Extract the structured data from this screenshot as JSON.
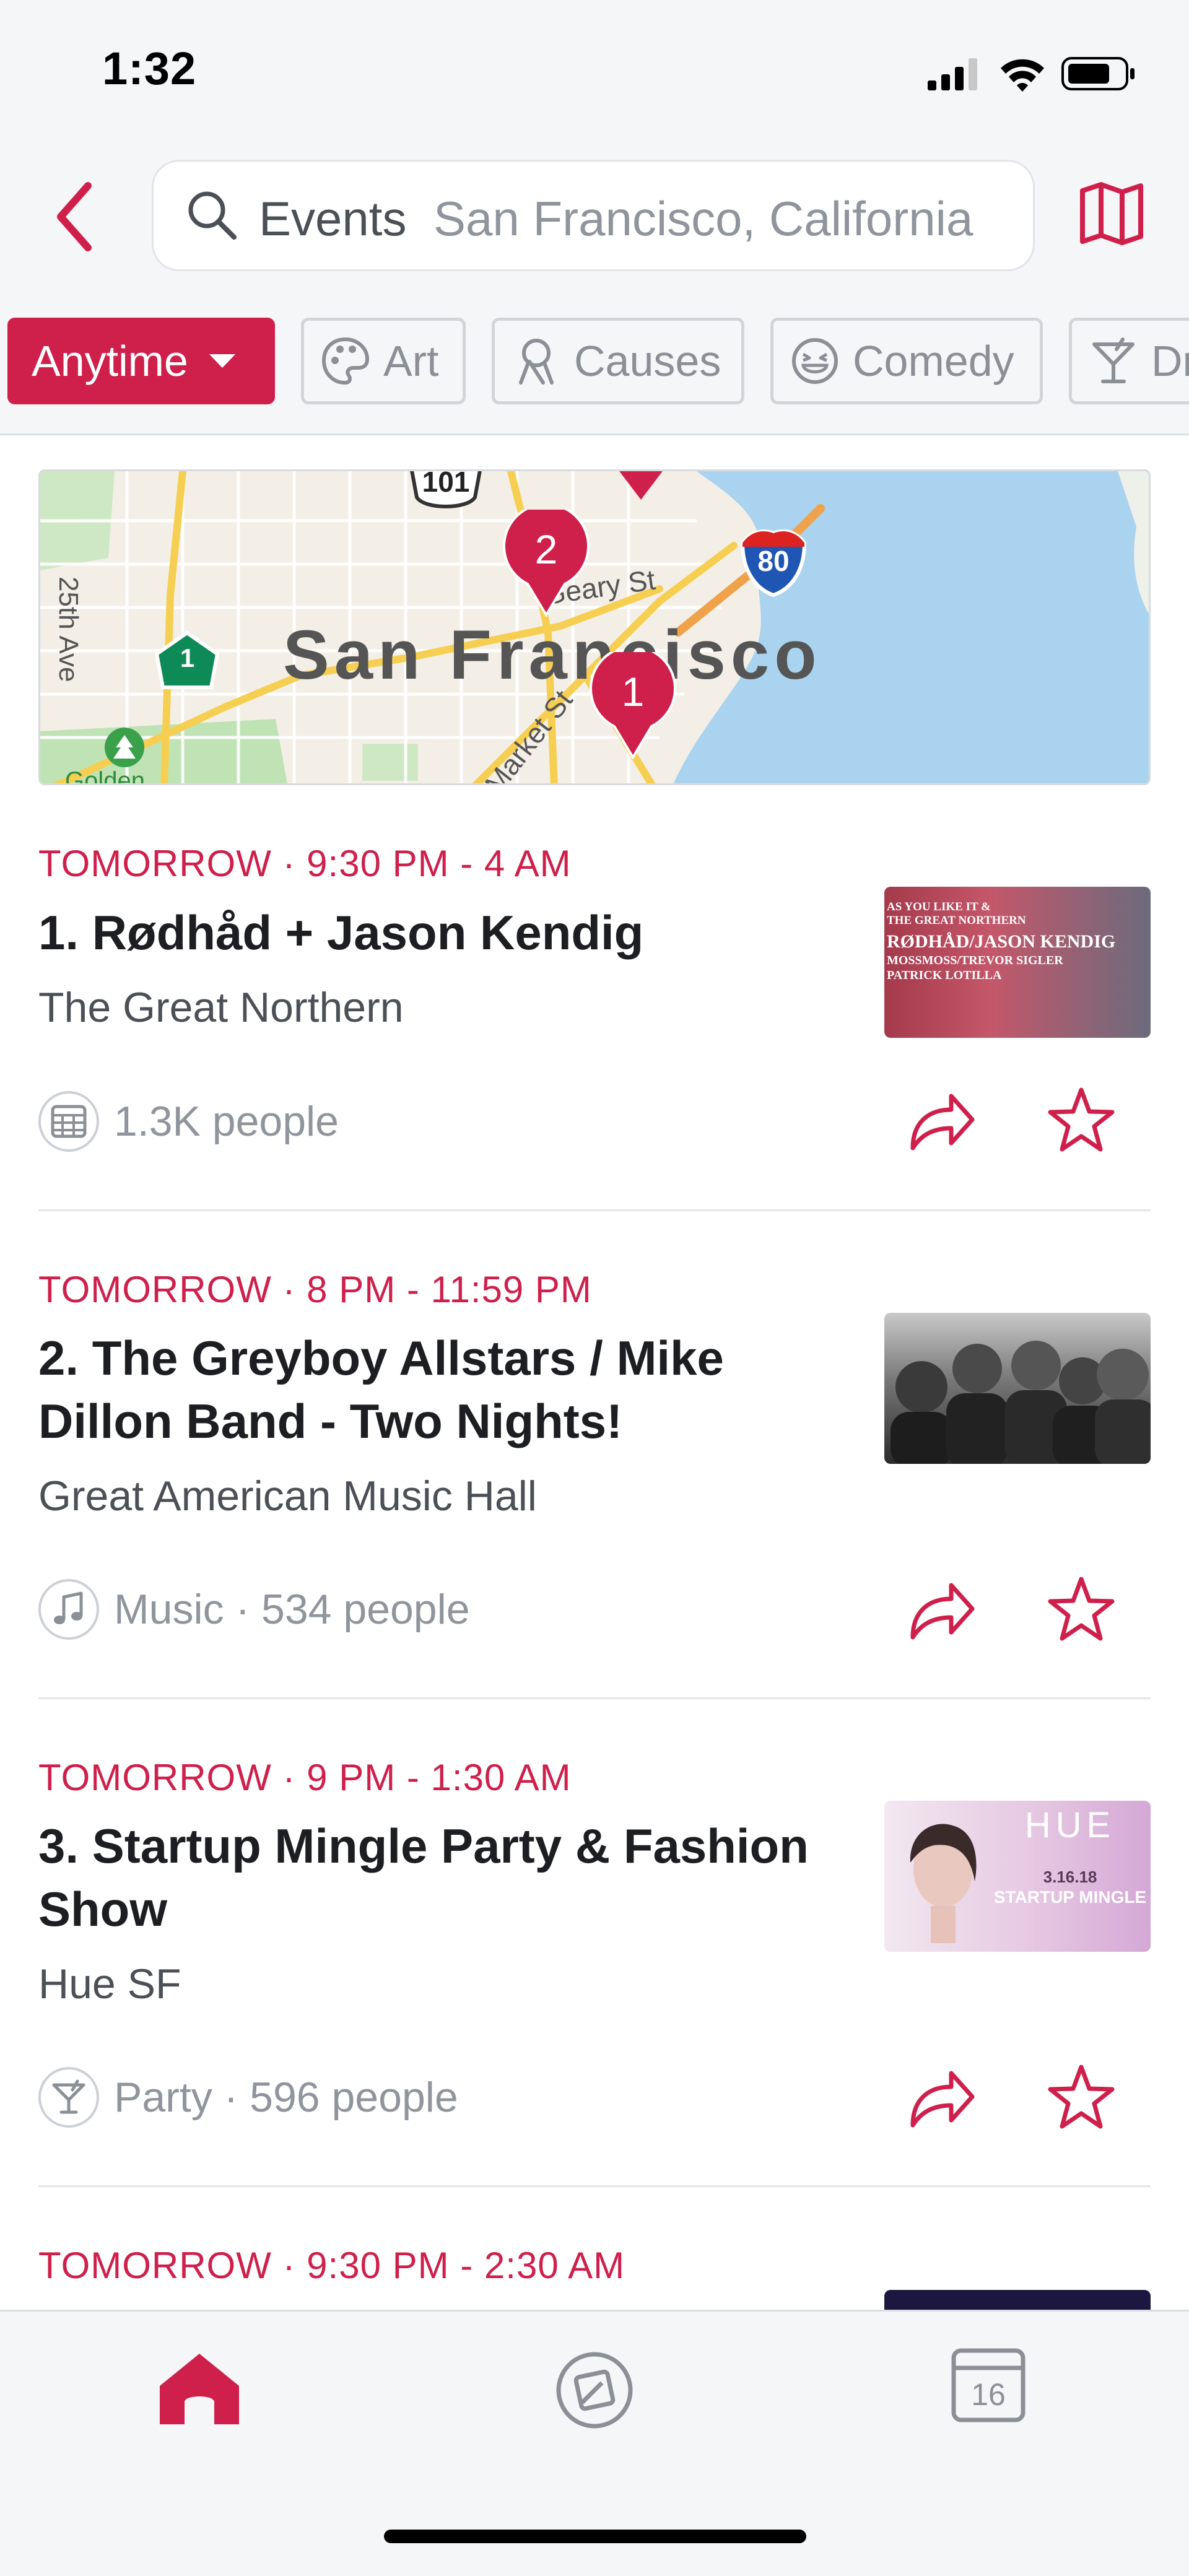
{
  "status_bar": {
    "time": "1:32"
  },
  "search": {
    "label": "Events",
    "location": "San Francisco, California"
  },
  "filters": {
    "anytime": "Anytime",
    "categories": [
      "Art",
      "Causes",
      "Comedy",
      "Dr"
    ]
  },
  "map": {
    "city_label": "San Francisco",
    "street_labels": [
      "Geary St",
      "Market St",
      "25th Ave",
      "Golden"
    ],
    "highway_shields": [
      "101",
      "80",
      "1"
    ],
    "pins": [
      "2",
      "1"
    ]
  },
  "events": [
    {
      "when": "TOMORROW · 9:30 PM - 4 AM",
      "title": "1. Rødhåd + Jason Kendig",
      "venue": "The Great Northern",
      "meta": "1.3K people",
      "category_icon": "calendar-grid-icon",
      "poster": {
        "line1": "AS YOU LIKE IT &",
        "line2": "THE GREAT NORTHERN",
        "line3": "RØDHÅD/JASON KENDIG",
        "line4": "MOSSMOSS/TREVOR SIGLER",
        "line5": "PATRICK LOTILLA"
      }
    },
    {
      "when": "TOMORROW · 8 PM - 11:59 PM",
      "title": "2. The Greyboy Allstars / Mike Dillon Band - Two Nights!",
      "venue": "Great American Music Hall",
      "meta": "Music · 534 people",
      "category_icon": "music-note-icon"
    },
    {
      "when": "TOMORROW · 9 PM - 1:30 AM",
      "title": "3. Startup Mingle Party & Fashion Show",
      "venue": "Hue SF",
      "meta": "Party · 596 people",
      "category_icon": "cocktail-icon",
      "poster": {
        "brand": "HUE",
        "date": "3.16.18",
        "headline": "STARTUP MINGLE"
      }
    },
    {
      "when": "TOMORROW · 9:30 PM - 2:30 AM"
    }
  ],
  "tabbar": {
    "calendar_day": "16"
  },
  "colors": {
    "accent": "#cf1f4b",
    "background": "#f5f6f7"
  }
}
